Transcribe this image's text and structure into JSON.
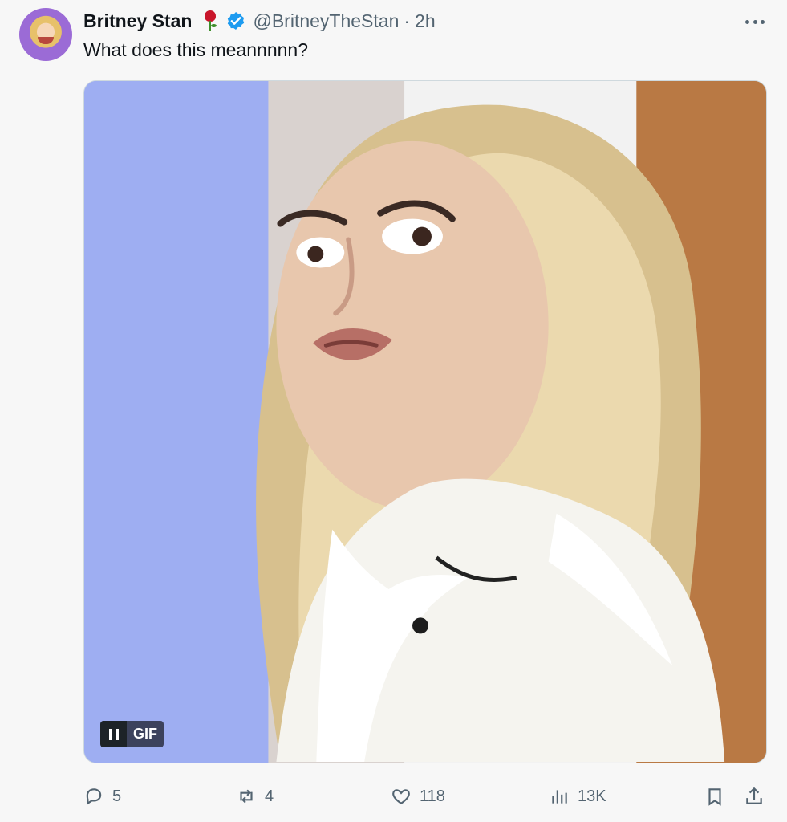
{
  "tweet": {
    "display_name": "Britney Stan",
    "handle": "@BritneyTheStan",
    "separator": "·",
    "time": "2h",
    "text": "What does this meannnnn?",
    "icons": {
      "avatar": "avatar",
      "rose": "rose-icon",
      "verified": "verified-badge-icon",
      "more": "more-options-icon"
    },
    "media": {
      "gif_label": "GIF",
      "control_icon": "pause-icon"
    },
    "actions": {
      "reply_count": "5",
      "retweet_count": "4",
      "like_count": "118",
      "views_count": "13K"
    }
  },
  "colors": {
    "text": "#0f1419",
    "secondary_text": "#536471",
    "verified": "#1d9bf0",
    "background": "#f7f7f7"
  }
}
